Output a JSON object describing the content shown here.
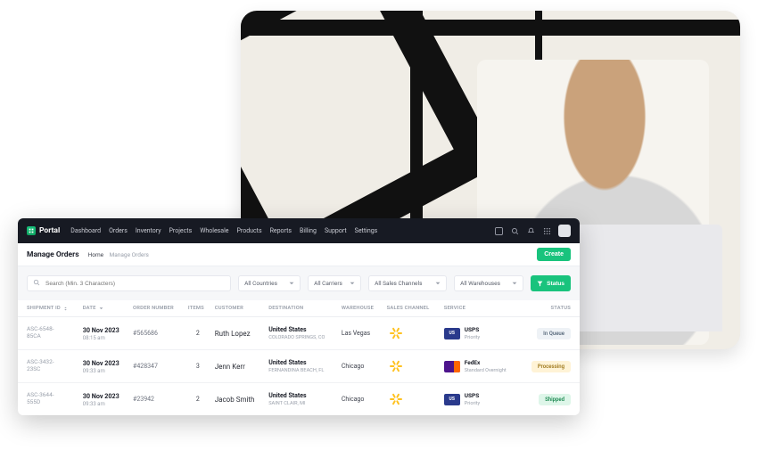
{
  "brand": "Portal",
  "nav": [
    "Dashboard",
    "Orders",
    "Inventory",
    "Projects",
    "Wholesale",
    "Products",
    "Reports",
    "Billing",
    "Support",
    "Settings"
  ],
  "page": {
    "title": "Manage Orders"
  },
  "breadcrumb": {
    "home": "Home",
    "current": "Manage Orders"
  },
  "buttons": {
    "create": "Create",
    "status": "Status"
  },
  "search": {
    "placeholder": "Search (Min. 3 Characters)"
  },
  "filters": {
    "countries": "All Countries",
    "carriers": "All Carriers",
    "channels": "All Sales Channels",
    "warehouses": "All Warehouses"
  },
  "columns": {
    "shipment": "SHIPMENT ID",
    "date": "DATE",
    "order": "ORDER NUMBER",
    "items": "ITEMS",
    "customer": "CUSTOMER",
    "destination": "DESTINATION",
    "warehouse": "WAREHOUSE",
    "channel": "SALES CHANNEL",
    "service": "SERVICE",
    "status": "STATUS"
  },
  "rows": [
    {
      "sid_a": "ASC-6548-",
      "sid_b": "85CA",
      "date": "30 Nov 2023",
      "time": "08:15 am",
      "order": "#565686",
      "items": "2",
      "customer": "Ruth Lopez",
      "dest_country": "United States",
      "dest_sub": "COLORADO SPRINGS, CO",
      "warehouse": "Las Vegas",
      "service": "USPS",
      "service_sub": "Priority",
      "carrier": "usps",
      "status": "In Queue",
      "status_class": "b-queue"
    },
    {
      "sid_a": "ASC-3432-",
      "sid_b": "23SC",
      "date": "30 Nov 2023",
      "time": "09:33 am",
      "order": "#428347",
      "items": "3",
      "customer": "Jenn Kerr",
      "dest_country": "United States",
      "dest_sub": "Fernandina Beach, FL",
      "warehouse": "Chicago",
      "service": "FedEx",
      "service_sub": "Standard Overnight",
      "carrier": "fedex",
      "status": "Processing",
      "status_class": "b-proc"
    },
    {
      "sid_a": "ASC-3644-",
      "sid_b": "555D",
      "date": "30 Nov 2023",
      "time": "09:33 am",
      "order": "#23942",
      "items": "2",
      "customer": "Jacob Smith",
      "dest_country": "United States",
      "dest_sub": "Saint Clair, MI",
      "warehouse": "Chicago",
      "service": "USPS",
      "service_sub": "Priority",
      "carrier": "usps",
      "status": "Shipped",
      "status_class": "b-ship"
    }
  ]
}
